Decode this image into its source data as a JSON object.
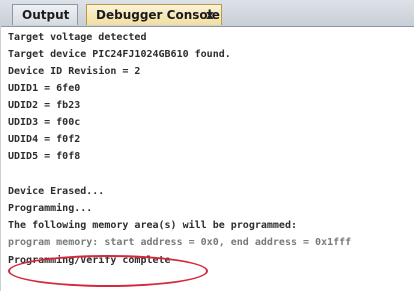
{
  "tabs": {
    "output_label": "Output",
    "debugger_label": "Debugger Console",
    "close_glyph": "x"
  },
  "console": {
    "lines": [
      "Target voltage detected",
      "Target device PIC24FJ1024GB610 found.",
      "Device ID Revision = 2",
      "UDID1 = 6fe0",
      "UDID2 = fb23",
      "UDID3 = f00c",
      "UDID4 = f0f2",
      "UDID5 = f0f8",
      "",
      "Device Erased...",
      "Programming...",
      "The following memory area(s) will be programmed:",
      "program memory: start address = 0x0, end address = 0x1fff",
      "Programming/Verify complete"
    ]
  },
  "colors": {
    "highlight_ellipse": "#d6283c",
    "active_tab": "#f2dfa0"
  }
}
